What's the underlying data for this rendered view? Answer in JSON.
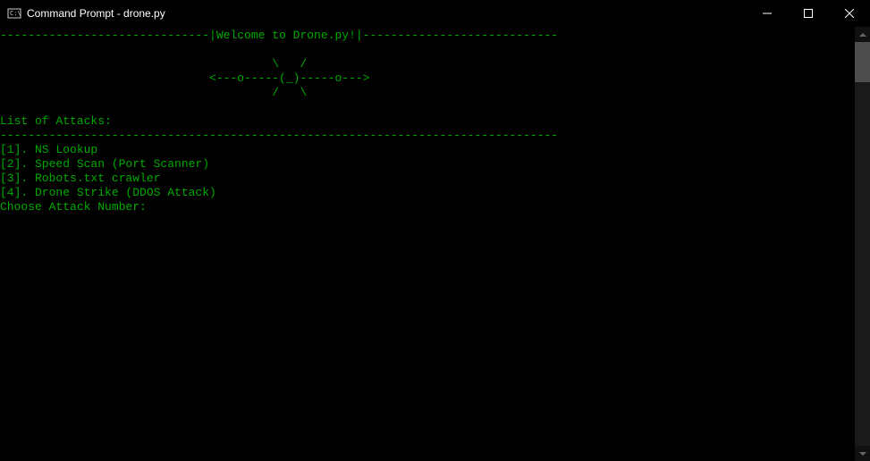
{
  "titlebar": {
    "title": "Command Prompt - drone.py"
  },
  "terminal": {
    "line1": "------------------------------|Welcome to Drone.py!|----------------------------",
    "line2": "",
    "line3": "                                       \\   /",
    "line4": "                              <---o-----(_)-----o--->",
    "line5": "                                       /   \\",
    "line6": "",
    "line7": "List of Attacks:",
    "line8": "--------------------------------------------------------------------------------",
    "line9": "[1]. NS Lookup",
    "line10": "[2]. Speed Scan (Port Scanner)",
    "line11": "[3]. Robots.txt crawler",
    "line12": "[4]. Drone Strike (DDOS Attack)",
    "line13": "Choose Attack Number: "
  }
}
